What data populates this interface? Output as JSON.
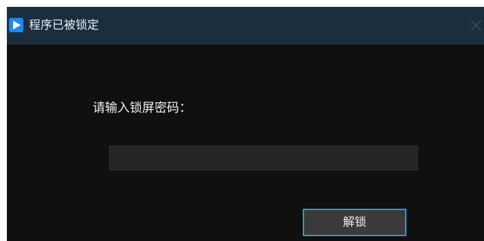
{
  "window": {
    "title": "程序已被锁定",
    "app_icon": "play-icon",
    "close_icon": "close-icon"
  },
  "lock": {
    "prompt": "请输入锁屏密码：",
    "password_value": "",
    "unlock_label": "解锁"
  },
  "colors": {
    "titlebar": "#1a2e3f",
    "body_background": "#101010",
    "accent": "#1aa6d6",
    "icon_blue": "#1e88f0"
  }
}
